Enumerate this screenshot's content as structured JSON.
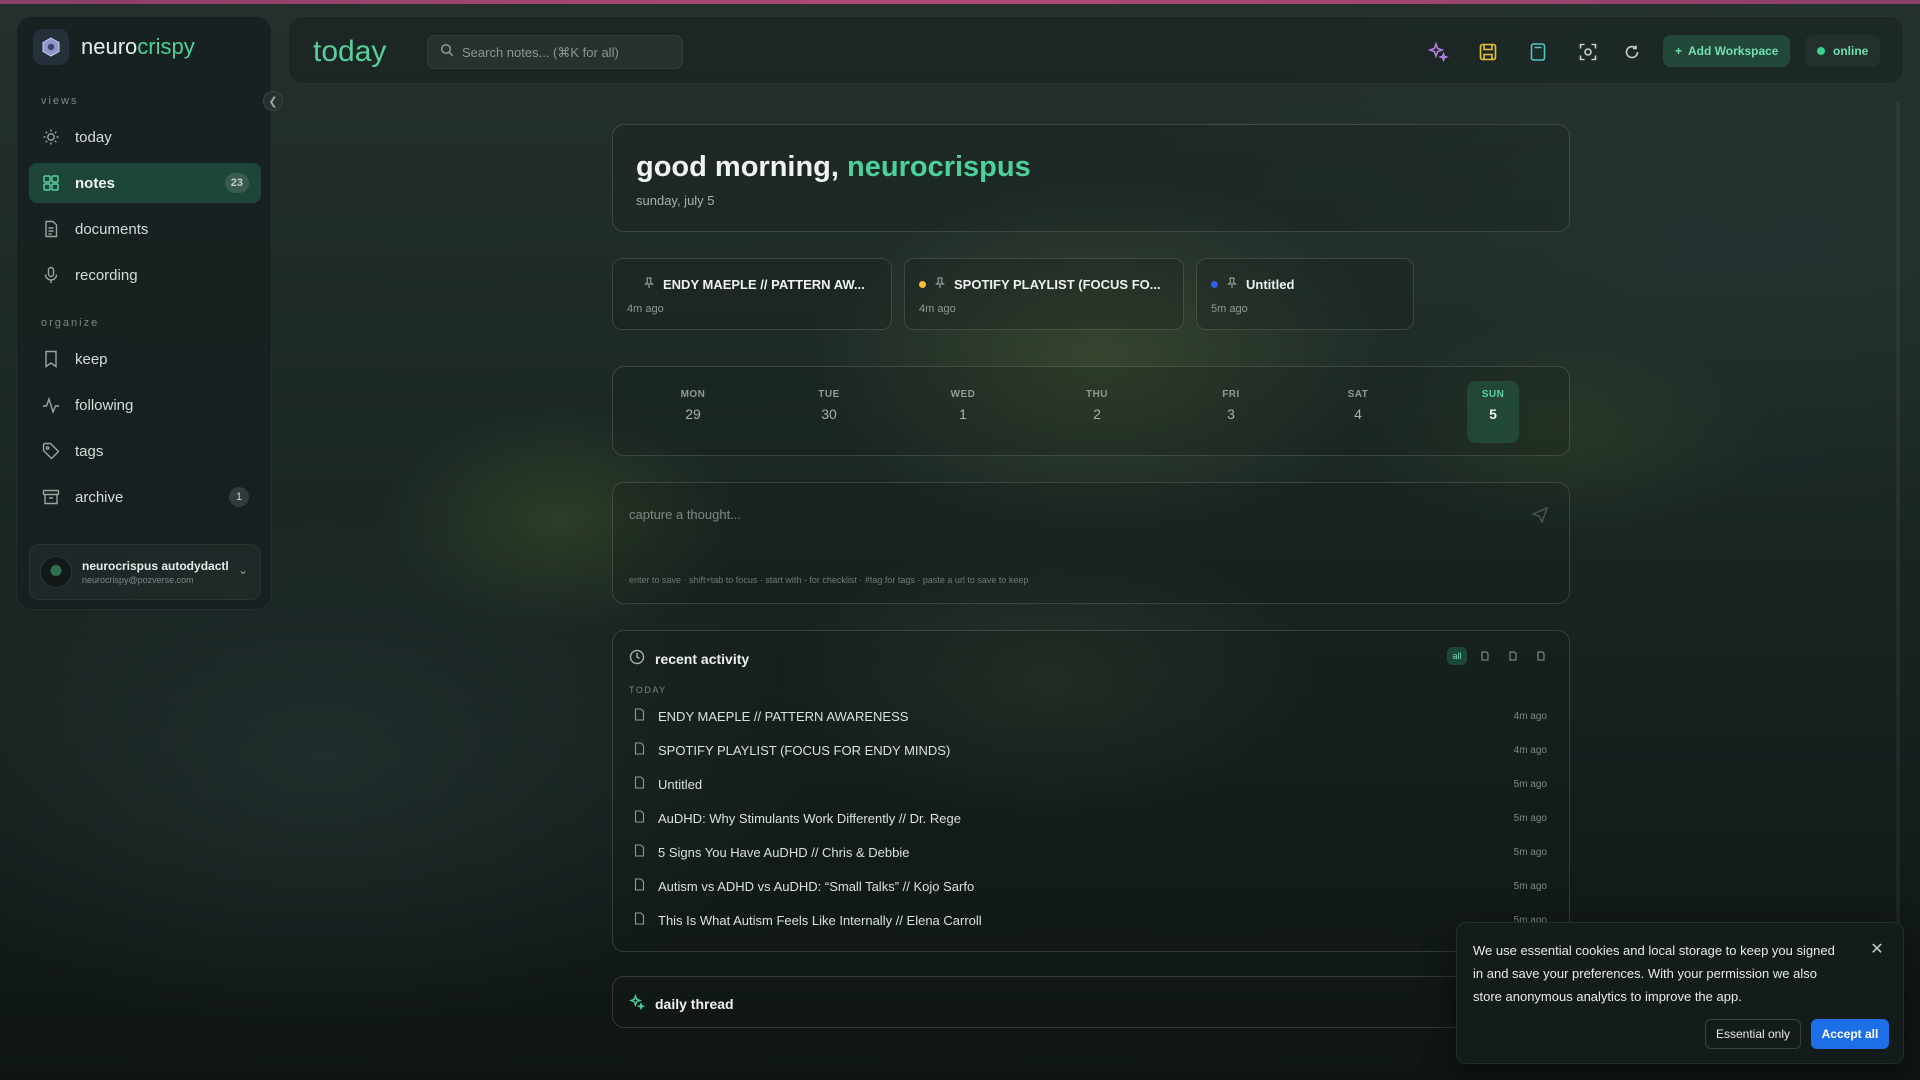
{
  "app": {
    "brand_a": "neuro",
    "brand_b": "crispy"
  },
  "sidebar": {
    "views_label": "views",
    "organize_label": "organize",
    "views": [
      {
        "label": "today",
        "icon": "sun-icon"
      },
      {
        "label": "notes",
        "icon": "grid-icon",
        "badge": "23",
        "active": true
      },
      {
        "label": "documents",
        "icon": "document-icon"
      },
      {
        "label": "recording",
        "icon": "microphone-icon"
      }
    ],
    "organize": [
      {
        "label": "keep",
        "icon": "bookmark-icon"
      },
      {
        "label": "following",
        "icon": "activity-icon"
      },
      {
        "label": "tags",
        "icon": "tag-icon"
      },
      {
        "label": "archive",
        "icon": "archive-icon",
        "badge": "1"
      }
    ],
    "user": {
      "name": "neurocrispus autodydactl",
      "email": "neurocrispy@pozverse.com"
    }
  },
  "header": {
    "title": "today",
    "search_placeholder": "Search notes... (⌘K for all)",
    "add_workspace": "Add Workspace",
    "status": "online"
  },
  "greeting": {
    "prefix": "good morning, ",
    "name": "neurocrispus",
    "date": "sunday, july 5"
  },
  "pinned": [
    {
      "title": "ENDY MAEPLE // PATTERN AW...",
      "time": "4m ago",
      "dot": ""
    },
    {
      "title": "SPOTIFY PLAYLIST (FOCUS FO...",
      "time": "4m ago",
      "dot": "#f2c230"
    },
    {
      "title": "Untitled",
      "time": "5m ago",
      "dot": "#2f5ee8"
    }
  ],
  "week": [
    {
      "name": "MON",
      "num": "29"
    },
    {
      "name": "TUE",
      "num": "30"
    },
    {
      "name": "WED",
      "num": "1"
    },
    {
      "name": "THU",
      "num": "2"
    },
    {
      "name": "FRI",
      "num": "3"
    },
    {
      "name": "SAT",
      "num": "4"
    },
    {
      "name": "SUN",
      "num": "5",
      "today": true
    }
  ],
  "capture": {
    "placeholder": "capture a thought...",
    "hint": "enter to save · shift+tab to focus · start with - for checklist · #tag for tags · paste a url to save to keep"
  },
  "activity": {
    "title": "recent activity",
    "filter_all": "all",
    "group_label": "TODAY",
    "items": [
      {
        "title": "ENDY MAEPLE // PATTERN AWARENESS",
        "time": "4m ago"
      },
      {
        "title": "SPOTIFY PLAYLIST (FOCUS FOR ENDY MINDS)",
        "time": "4m ago"
      },
      {
        "title": "Untitled",
        "time": "5m ago"
      },
      {
        "title": "AuDHD: Why Stimulants Work Differently // Dr. Rege",
        "time": "5m ago"
      },
      {
        "title": "5 Signs You Have AuDHD // Chris & Debbie",
        "time": "5m ago"
      },
      {
        "title": "Autism vs ADHD vs AuDHD: “Small Talks” // Kojo Sarfo",
        "time": "5m ago"
      },
      {
        "title": "This Is What Autism Feels Like Internally // Elena Carroll",
        "time": "5m ago"
      }
    ]
  },
  "thread": {
    "title": "daily thread"
  },
  "cookie": {
    "text": "We use essential cookies and local storage to keep you signed in and save your preferences. With your permission we also store anonymous analytics to improve the app.",
    "essential": "Essential only",
    "accept": "Accept all"
  },
  "colors": {
    "accent": "#4bd19a",
    "accept_button": "#1d6fe8",
    "top_line": "#b14a78"
  }
}
